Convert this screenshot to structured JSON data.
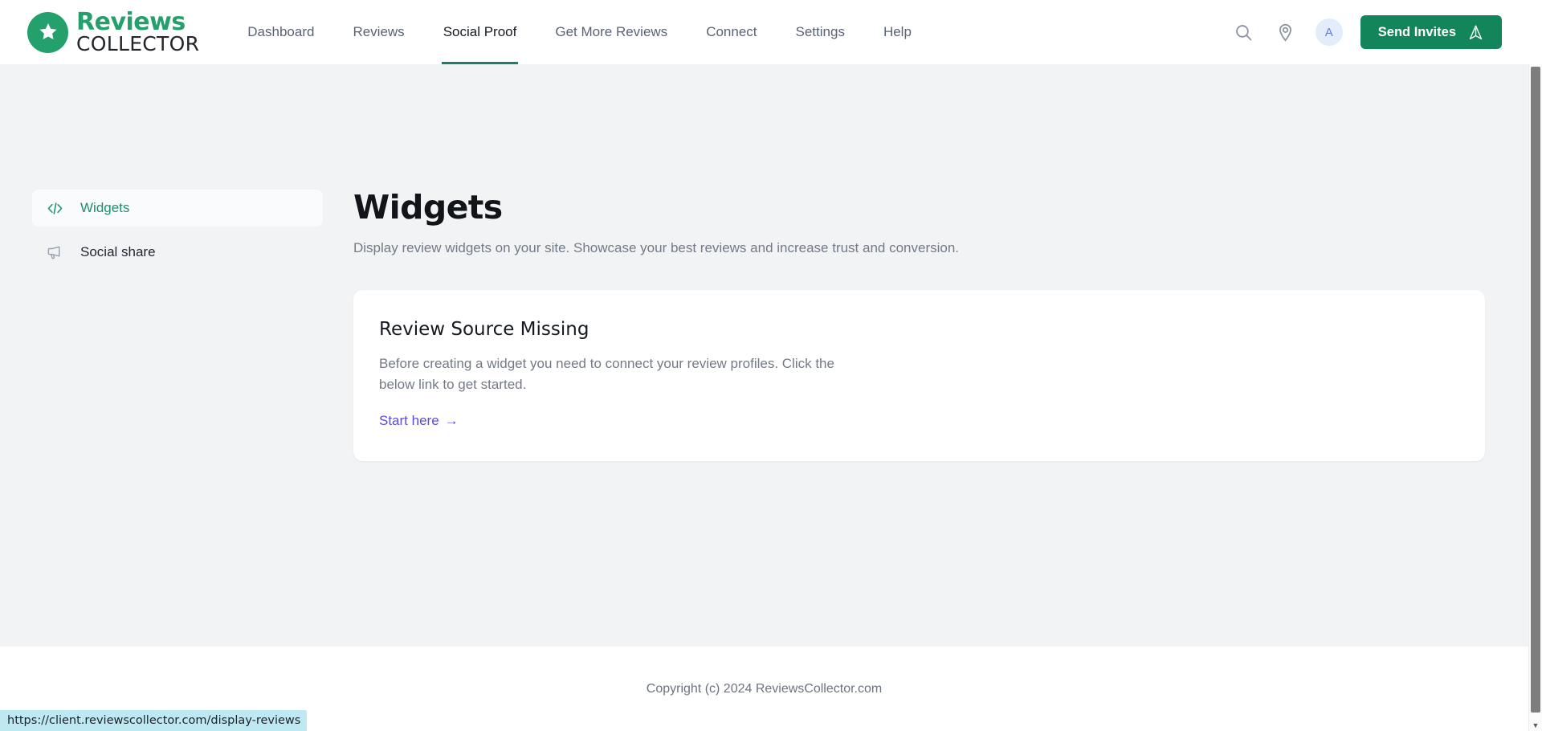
{
  "header": {
    "logo": {
      "line1": "Reviews",
      "line2": "COLLECTOR",
      "icon": "star-icon"
    },
    "nav": [
      {
        "label": "Dashboard",
        "active": false
      },
      {
        "label": "Reviews",
        "active": false
      },
      {
        "label": "Social Proof",
        "active": true
      },
      {
        "label": "Get More Reviews",
        "active": false
      },
      {
        "label": "Connect",
        "active": false
      },
      {
        "label": "Settings",
        "active": false
      },
      {
        "label": "Help",
        "active": false
      }
    ],
    "search_icon": "search-icon",
    "location_icon": "map-pin-icon",
    "avatar_initial": "A",
    "send_invites_label": "Send Invites",
    "send_invites_icon": "send-icon"
  },
  "sidebar": {
    "items": [
      {
        "label": "Widgets",
        "icon": "code-brackets-icon",
        "active": true
      },
      {
        "label": "Social share",
        "icon": "megaphone-icon",
        "active": false
      }
    ]
  },
  "main": {
    "title": "Widgets",
    "subtitle": "Display review widgets on your site. Showcase your best reviews and increase trust and conversion.",
    "card": {
      "title": "Review Source Missing",
      "text": "Before creating a widget you need to connect your review profiles. Click the below link to get started.",
      "link_label": "Start here",
      "link_arrow": "→"
    }
  },
  "footer": {
    "copyright": "Copyright (c) 2024 ReviewsCollector.com"
  },
  "statusbar": {
    "url": "https://client.reviewscollector.com/display-reviews"
  },
  "colors": {
    "brand_green": "#23a06c",
    "button_green": "#12865a",
    "active_tab_underline": "#1b7f6b",
    "link_purple": "#5b4ae0",
    "page_bg": "#f1f3f5",
    "status_bg": "#bfe9f2"
  }
}
